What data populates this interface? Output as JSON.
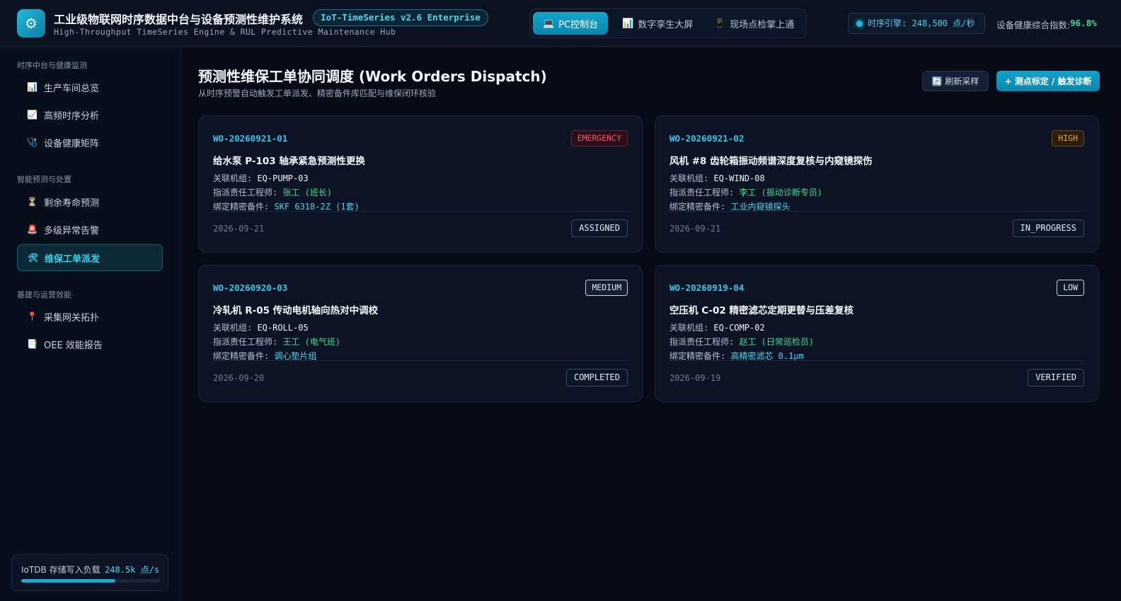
{
  "header": {
    "logo_icon": "gear-icon",
    "title": "工业级物联网时序数据中台与设备预测性维护系统",
    "version_badge": "IoT-TimeSeries v2.6 Enterprise",
    "subtitle": "High-Throughput TimeSeries Engine & RUL Predictive Maintenance Hub",
    "views": [
      {
        "icon": "💻",
        "label": "PC控制台",
        "active": true
      },
      {
        "icon": "📊",
        "label": "数字孪生大屏",
        "active": false
      },
      {
        "icon": "📱",
        "label": "现场点检掌上通",
        "active": false
      }
    ],
    "engine_status": "时序引擎: 248,500 点/秒",
    "health_label": "设备健康综合指数:",
    "health_value": "96.8%"
  },
  "sidebar": {
    "groups": [
      {
        "title": "时序中台与健康监测",
        "items": [
          {
            "icon": "📊",
            "label": "生产车间总览"
          },
          {
            "icon": "📈",
            "label": "高频时序分析"
          },
          {
            "icon": "🩺",
            "label": "设备健康矩阵"
          }
        ]
      },
      {
        "title": "智能预测与处置",
        "items": [
          {
            "icon": "⏳",
            "label": "剩余寿命预测"
          },
          {
            "icon": "🚨",
            "label": "多级异常告警"
          },
          {
            "icon": "🛠",
            "label": "维保工单派发",
            "active": true
          }
        ]
      },
      {
        "title": "基建与运营效能",
        "items": [
          {
            "icon": "📍",
            "label": "采集网关拓扑"
          },
          {
            "icon": "📑",
            "label": "OEE 效能报告"
          }
        ]
      }
    ],
    "load": {
      "label": "IoTDB 存储写入负载",
      "value": "248.5k 点/s",
      "fill_fraction": 0.68
    }
  },
  "main": {
    "title": "预测性维保工单协同调度 (Work Orders Dispatch)",
    "description": "从时序预警自动触发工单派发、精密备件库匹配与维保闭环核验",
    "refresh_label": "🔄 刷新采样",
    "primary_label": "+ 测点标定 / 触发诊断",
    "field_labels": {
      "equipment": "关联机组: ",
      "engineer": "指派责任工程师: ",
      "parts": "绑定精密备件: "
    },
    "orders": [
      {
        "id": "WO-20260921-01",
        "priority": "EMERGENCY",
        "title": "给水泵 P-103 轴承紧急预测性更换",
        "equipment": "EQ-PUMP-03",
        "engineer": "张工 (班长)",
        "parts": "SKF 6318-2Z (1套)",
        "date": "2026-09-21",
        "status": "ASSIGNED"
      },
      {
        "id": "WO-20260921-02",
        "priority": "HIGH",
        "title": "风机 #8 齿轮箱振动频谱深度复核与内窥镜探伤",
        "equipment": "EQ-WIND-08",
        "engineer": "李工 (振动诊断专员)",
        "parts": "工业内窥镜探头",
        "date": "2026-09-21",
        "status": "IN_PROGRESS"
      },
      {
        "id": "WO-20260920-03",
        "priority": "MEDIUM",
        "title": "冷轧机 R-05 传动电机轴向热对中调校",
        "equipment": "EQ-ROLL-05",
        "engineer": "王工 (电气班)",
        "parts": "调心垫片组",
        "date": "2026-09-20",
        "status": "COMPLETED"
      },
      {
        "id": "WO-20260919-04",
        "priority": "LOW",
        "title": "空压机 C-02 精密滤芯定期更替与压差复核",
        "equipment": "EQ-COMP-02",
        "engineer": "赵工 (日常巡检员)",
        "parts": "高精密滤芯 0.1μm",
        "date": "2026-09-19",
        "status": "VERIFIED"
      }
    ]
  }
}
